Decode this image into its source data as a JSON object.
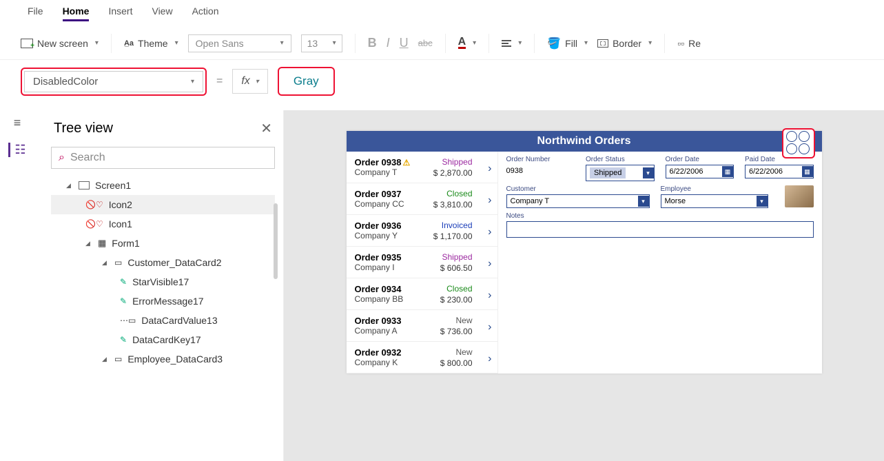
{
  "menu": {
    "file": "File",
    "home": "Home",
    "insert": "Insert",
    "view": "View",
    "action": "Action"
  },
  "toolbar": {
    "new_screen": "New screen",
    "theme": "Theme",
    "font": "Open Sans",
    "font_size": "13",
    "fill": "Fill",
    "border": "Border",
    "reorder": "Re"
  },
  "formula": {
    "property": "DisabledColor",
    "value": "Gray"
  },
  "tree": {
    "title": "Tree view",
    "search_placeholder": "Search",
    "screen": "Screen1",
    "icon2": "Icon2",
    "icon1": "Icon1",
    "form1": "Form1",
    "cust_dc": "Customer_DataCard2",
    "star": "StarVisible17",
    "err": "ErrorMessage17",
    "dcv": "DataCardValue13",
    "dck": "DataCardKey17",
    "emp_dc": "Employee_DataCard3"
  },
  "app": {
    "title": "Northwind Orders",
    "orders": [
      {
        "id": "Order 0938",
        "warn": true,
        "company": "Company T",
        "status": "Shipped",
        "amount": "$ 2,870.00",
        "status_cls": "shipped"
      },
      {
        "id": "Order 0937",
        "company": "Company CC",
        "status": "Closed",
        "amount": "$ 3,810.00",
        "status_cls": "closed"
      },
      {
        "id": "Order 0936",
        "company": "Company Y",
        "status": "Invoiced",
        "amount": "$ 1,170.00",
        "status_cls": "invoiced"
      },
      {
        "id": "Order 0935",
        "company": "Company I",
        "status": "Shipped",
        "amount": "$ 606.50",
        "status_cls": "shipped"
      },
      {
        "id": "Order 0934",
        "company": "Company BB",
        "status": "Closed",
        "amount": "$ 230.00",
        "status_cls": "closed"
      },
      {
        "id": "Order 0933",
        "company": "Company A",
        "status": "New",
        "amount": "$ 736.00",
        "status_cls": "new"
      },
      {
        "id": "Order 0932",
        "company": "Company K",
        "status": "New",
        "amount": "$ 800.00",
        "status_cls": "new"
      }
    ],
    "detail": {
      "order_number_label": "Order Number",
      "order_number": "0938",
      "order_status_label": "Order Status",
      "order_status": "Shipped",
      "order_date_label": "Order Date",
      "order_date": "6/22/2006",
      "paid_date_label": "Paid Date",
      "paid_date": "6/22/2006",
      "customer_label": "Customer",
      "customer": "Company T",
      "employee_label": "Employee",
      "employee": "Morse",
      "notes_label": "Notes"
    }
  }
}
